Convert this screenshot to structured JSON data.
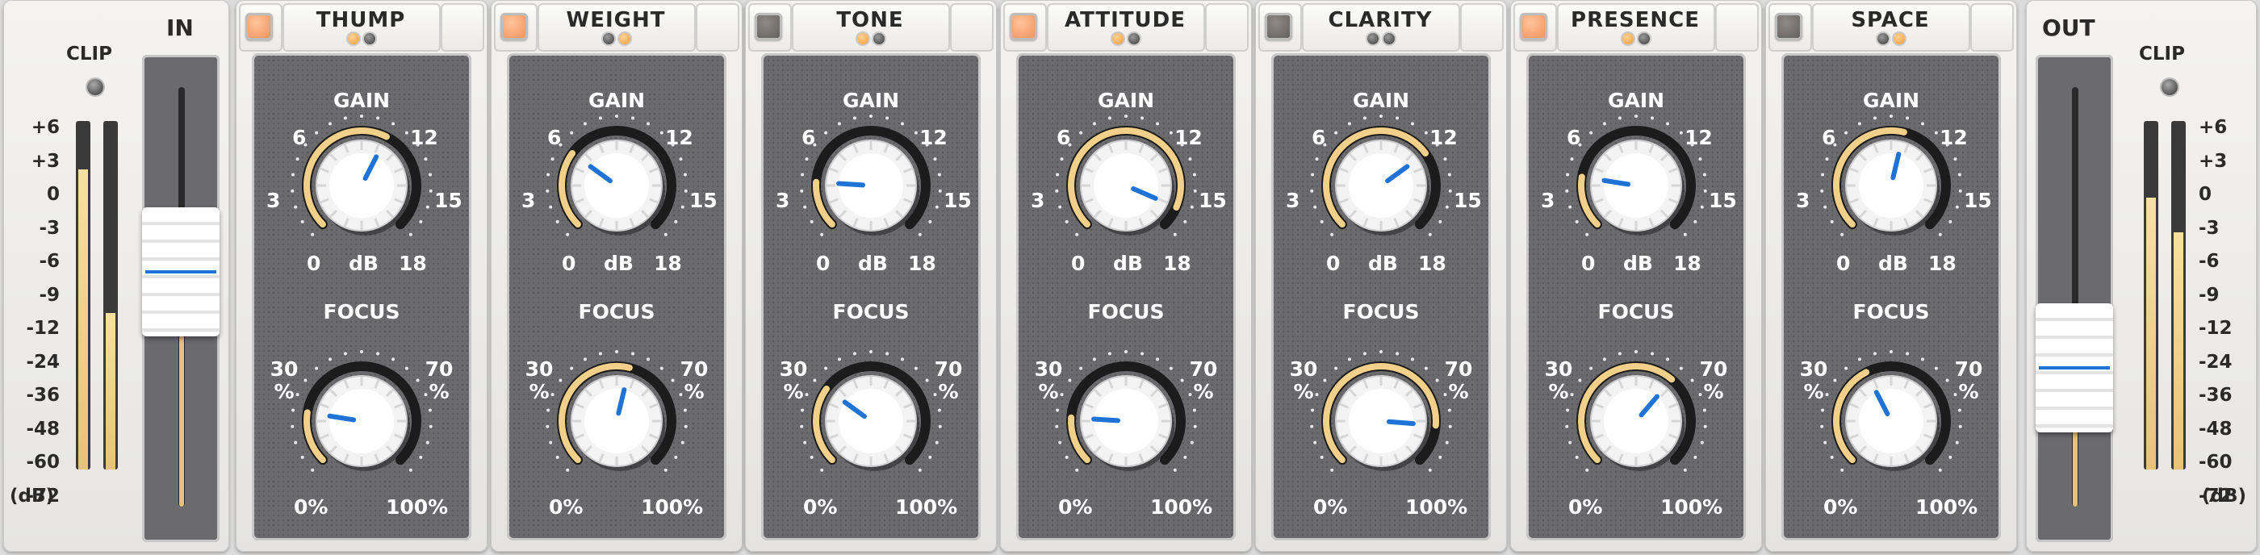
{
  "input": {
    "title": "IN",
    "clip_label": "CLIP",
    "unit": "(dB)",
    "scale": [
      "+6",
      "+3",
      "0",
      "-3",
      "-6",
      "-9",
      "-12",
      "-24",
      "-36",
      "-48",
      "-60",
      "-72"
    ],
    "meter_level_l": 0.86,
    "meter_level_r": 0.45,
    "fader_level": 0.56
  },
  "output": {
    "title": "OUT",
    "clip_label": "CLIP",
    "unit": "(dB)",
    "scale": [
      "+6",
      "+3",
      "0",
      "-3",
      "-6",
      "-9",
      "-12",
      "-24",
      "-36",
      "-48",
      "-60",
      "-72"
    ],
    "meter_level_l": 0.78,
    "meter_level_r": 0.68,
    "fader_level": 0.33
  },
  "knob_labels": {
    "gain_title": "GAIN",
    "gain_scale": [
      "3",
      "6",
      "12",
      "15",
      "0",
      "dB",
      "18"
    ],
    "focus_title": "FOCUS",
    "focus_scale": [
      "30 %",
      "70 %",
      "0%",
      "100%"
    ]
  },
  "bands": [
    {
      "name": "THUMP",
      "enabled": true,
      "leds": [
        "orange",
        "dark"
      ],
      "gain": 0.6,
      "focus": 0.2
    },
    {
      "name": "WEIGHT",
      "enabled": true,
      "leds": [
        "dark",
        "orange"
      ],
      "gain": 0.3,
      "focus": 0.55
    },
    {
      "name": "TONE",
      "enabled": false,
      "leds": [
        "orange",
        "dark"
      ],
      "gain": 0.18,
      "focus": 0.3
    },
    {
      "name": "ATTITUDE",
      "enabled": true,
      "leds": [
        "orange",
        "dark"
      ],
      "gain": 0.92,
      "focus": 0.18
    },
    {
      "name": "CLARITY",
      "enabled": false,
      "leds": [
        "dark",
        "dark"
      ],
      "gain": 0.7,
      "focus": 0.85
    },
    {
      "name": "PRESENCE",
      "enabled": true,
      "leds": [
        "orange",
        "dark"
      ],
      "gain": 0.2,
      "focus": 0.65
    },
    {
      "name": "SPACE",
      "enabled": false,
      "leds": [
        "dark",
        "orange"
      ],
      "gain": 0.55,
      "focus": 0.4
    }
  ],
  "colors": {
    "accent_orange": "#f39a30",
    "knob_arc": "#f2d08a",
    "pointer_blue": "#1f73d6",
    "band_bg": "#6b6b6e"
  }
}
